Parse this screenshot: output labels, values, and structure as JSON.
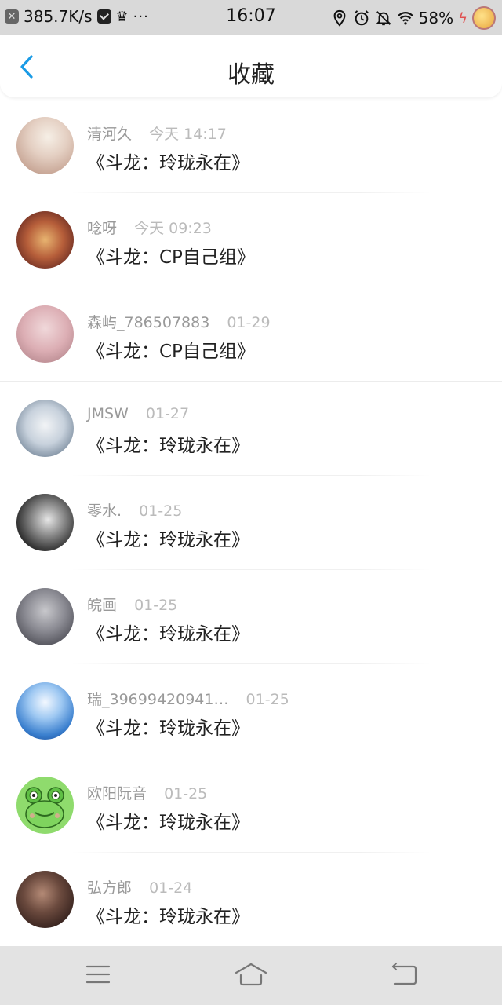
{
  "status_bar": {
    "net_speed": "385.7K/s",
    "dots": "···",
    "time": "16:07",
    "battery": "58%",
    "icons": [
      "x-icon",
      "mail-icon",
      "crown-icon",
      "location-icon",
      "alarm-icon",
      "mute-icon",
      "wifi-icon",
      "charging-icon",
      "bee-app-icon"
    ]
  },
  "header": {
    "title": "收藏",
    "back_icon": "chevron-left-icon"
  },
  "items": [
    {
      "name": "清河久",
      "time": "今天 14:17",
      "title": "《斗龙：玲珑永在》"
    },
    {
      "name": "唸呀",
      "time": "今天 09:23",
      "title": "《斗龙：CP自己组》"
    },
    {
      "name": "森屿_786507883",
      "time": "01-29",
      "title": "《斗龙：CP自己组》"
    },
    {
      "name": "JMSW",
      "time": "01-27",
      "title": "《斗龙：玲珑永在》"
    },
    {
      "name": "零水.",
      "time": "01-25",
      "title": "《斗龙：玲珑永在》"
    },
    {
      "name": "皖画",
      "time": "01-25",
      "title": "《斗龙：玲珑永在》"
    },
    {
      "name": "瑞_39699420941…",
      "time": "01-25",
      "title": "《斗龙：玲珑永在》"
    },
    {
      "name": "欧阳阮音",
      "time": "01-25",
      "title": "《斗龙：玲珑永在》"
    },
    {
      "name": "弘方郎",
      "time": "01-24",
      "title": "《斗龙：玲珑永在》"
    }
  ],
  "navbar": {
    "icons": [
      "menu-icon",
      "home-icon",
      "back-icon"
    ]
  },
  "colors": {
    "accent": "#1a9be6",
    "status_bar_bg": "#d9d9d9",
    "nav_bg": "#e3e3e3"
  }
}
